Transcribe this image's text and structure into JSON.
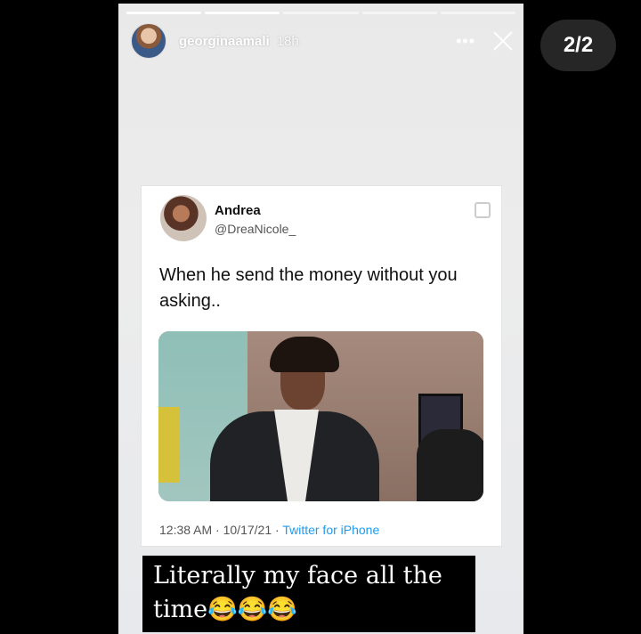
{
  "story": {
    "progress_segments": [
      true,
      true,
      false,
      false,
      false
    ],
    "username": "georginaamali",
    "time_ago": "18h",
    "more_label": "•••",
    "counter": "2/2"
  },
  "tweet": {
    "name": "Andrea",
    "handle": "@DreaNicole_",
    "text": "When he send the money without you asking..",
    "time": "12:38 AM",
    "date": "10/17/21",
    "separator": " · ",
    "source": "Twitter for iPhone"
  },
  "caption": {
    "text": "Literally my face all the time😂😂😂"
  },
  "colors": {
    "background": "#000000",
    "link": "#1d9bf0",
    "counter_bg": "#262626"
  }
}
